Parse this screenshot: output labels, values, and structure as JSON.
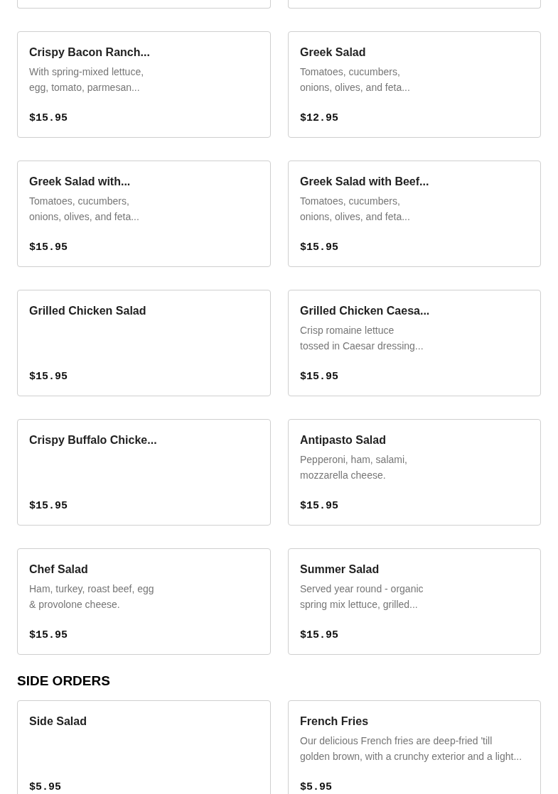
{
  "sections": [
    {
      "items": [
        {
          "name": "Crispy Bacon Ranch...",
          "description": "With spring-mixed lettuce,\negg, tomato, parmesan...",
          "price": "$15.95"
        },
        {
          "name": "Greek Salad",
          "description": "Tomatoes, cucumbers,\nonions, olives, and feta...",
          "price": "$12.95"
        },
        {
          "name": "Greek Salad with...",
          "description": "Tomatoes, cucumbers,\nonions, olives, and feta...",
          "price": "$15.95"
        },
        {
          "name": "Greek Salad with Beef...",
          "description": "Tomatoes, cucumbers,\nonions, olives, and feta...",
          "price": "$15.95"
        },
        {
          "name": "Grilled Chicken Salad",
          "price": "$15.95"
        },
        {
          "name": "Grilled Chicken Caesa...",
          "description": "Crisp romaine lettuce\ntossed in Caesar dressing...",
          "price": "$15.95"
        },
        {
          "name": "Crispy Buffalo Chicke...",
          "price": "$15.95"
        },
        {
          "name": "Antipasto Salad",
          "description": "Pepperoni, ham, salami,\nmozzarella cheese.",
          "price": "$15.95"
        },
        {
          "name": "Chef Salad",
          "description": "Ham, turkey, roast beef, egg\n& provolone cheese.",
          "price": "$15.95"
        },
        {
          "name": "Summer Salad",
          "description": "Served year round - organic\nspring mix lettuce, grilled...",
          "price": "$15.95"
        }
      ]
    },
    {
      "title": "SIDE ORDERS",
      "items": [
        {
          "name": "Side Salad",
          "price": "$5.95"
        },
        {
          "name": "French Fries",
          "description": "Our delicious French fries are deep-fried 'till\ngolden brown, with a crunchy exterior and a light...",
          "price": "$5.95"
        }
      ]
    }
  ]
}
